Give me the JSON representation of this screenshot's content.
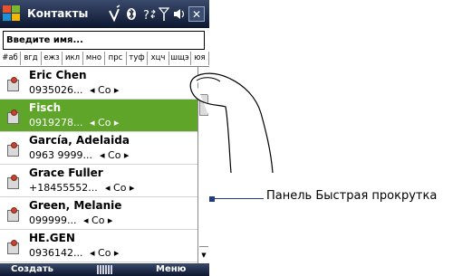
{
  "title": "Контакты",
  "status_icons": {
    "connectivity": "phone-signal-icon",
    "bluetooth": "bluetooth-icon",
    "data": "data-transfer-icon",
    "signal": "antenna-icon",
    "volume": "speaker-icon",
    "close_label": "✕"
  },
  "search": {
    "value": "Введите имя..."
  },
  "alphabet": [
    "#аб",
    "вгд",
    "ежз",
    "икл",
    "мно",
    "прс",
    "туф",
    "хцч",
    "шщэ",
    "юя"
  ],
  "contacts": [
    {
      "name": "Eric Chen",
      "number": "0935026...",
      "method": "◂ Co ▸",
      "selected": false
    },
    {
      "name": "Fisch",
      "number": "0919278...",
      "method": "◂ Co ▸",
      "selected": true
    },
    {
      "name": "García, Adelaida",
      "number": "0963 9999...",
      "method": "◂ Co ▸",
      "selected": false
    },
    {
      "name": "Grace Fuller",
      "number": "+18455552...",
      "method": "◂ Co ▸",
      "selected": false
    },
    {
      "name": "Green, Melanie",
      "number": "099999...",
      "method": "◂ Co ▸",
      "selected": false
    },
    {
      "name": "HE.GEN",
      "number": "0936142...",
      "method": "◂ Co ▸",
      "selected": false
    }
  ],
  "softkeys": {
    "left": "Создать",
    "right": "Меню"
  },
  "annotation": "Панель Быстрая прокрутка",
  "colors": {
    "selected": "#5fa52a",
    "titlebar": "#0d1730",
    "marker": "#1f3a8a"
  }
}
